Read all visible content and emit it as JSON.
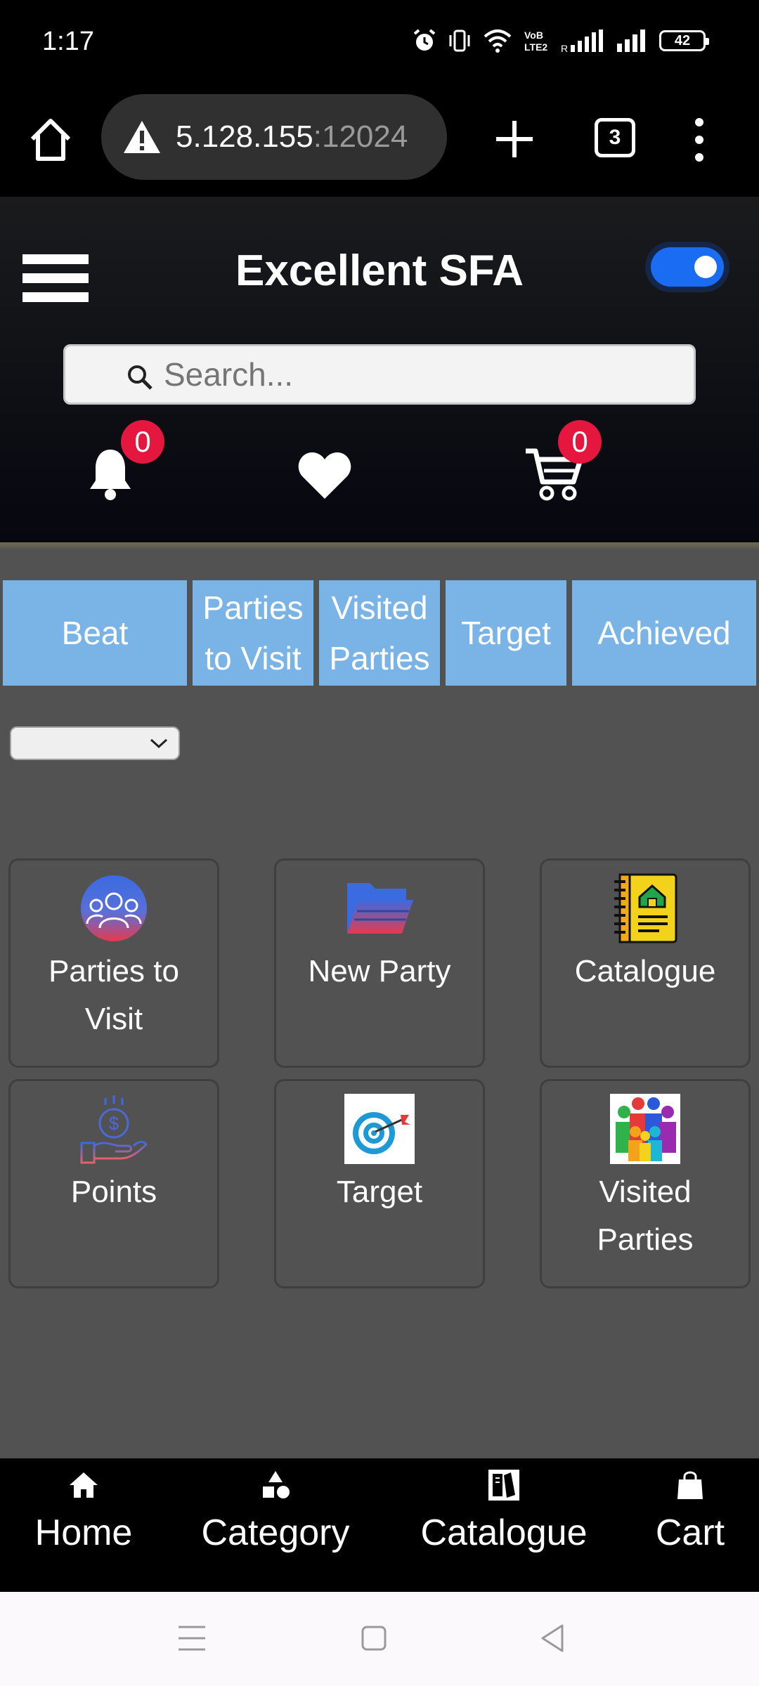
{
  "status_bar": {
    "time": "1:17",
    "battery": "42"
  },
  "browser": {
    "url_host": "5.128.155",
    "url_port": ":12024",
    "tab_count": "3"
  },
  "app": {
    "title": "Excellent SFA",
    "search_placeholder": "Search...",
    "notification_count": "0",
    "cart_count": "0"
  },
  "stat_tabs": [
    "Beat",
    "Parties to Visit",
    "Visited Parties",
    "Target",
    "Achieved"
  ],
  "beat_select": {
    "value": ""
  },
  "tiles": [
    {
      "label": "Parties to Visit",
      "icon": "group-icon"
    },
    {
      "label": "New Party",
      "icon": "folder-icon"
    },
    {
      "label": "Catalogue",
      "icon": "catalogue-book-icon"
    },
    {
      "label": "Points",
      "icon": "points-hand-icon"
    },
    {
      "label": "Target",
      "icon": "target-icon"
    },
    {
      "label": "Visited Parties",
      "icon": "people-circle-icon"
    }
  ],
  "bottom_nav": [
    {
      "label": "Home",
      "icon": "home-icon"
    },
    {
      "label": "Category",
      "icon": "category-shapes-icon"
    },
    {
      "label": "Catalogue",
      "icon": "catalogue-icon"
    },
    {
      "label": "Cart",
      "icon": "shopping-bag-icon"
    }
  ],
  "colors": {
    "tab_blue": "#7ab3e6",
    "badge_red": "#e5173f",
    "toggle_blue": "#1a6cf2",
    "main_bg": "#525252"
  }
}
